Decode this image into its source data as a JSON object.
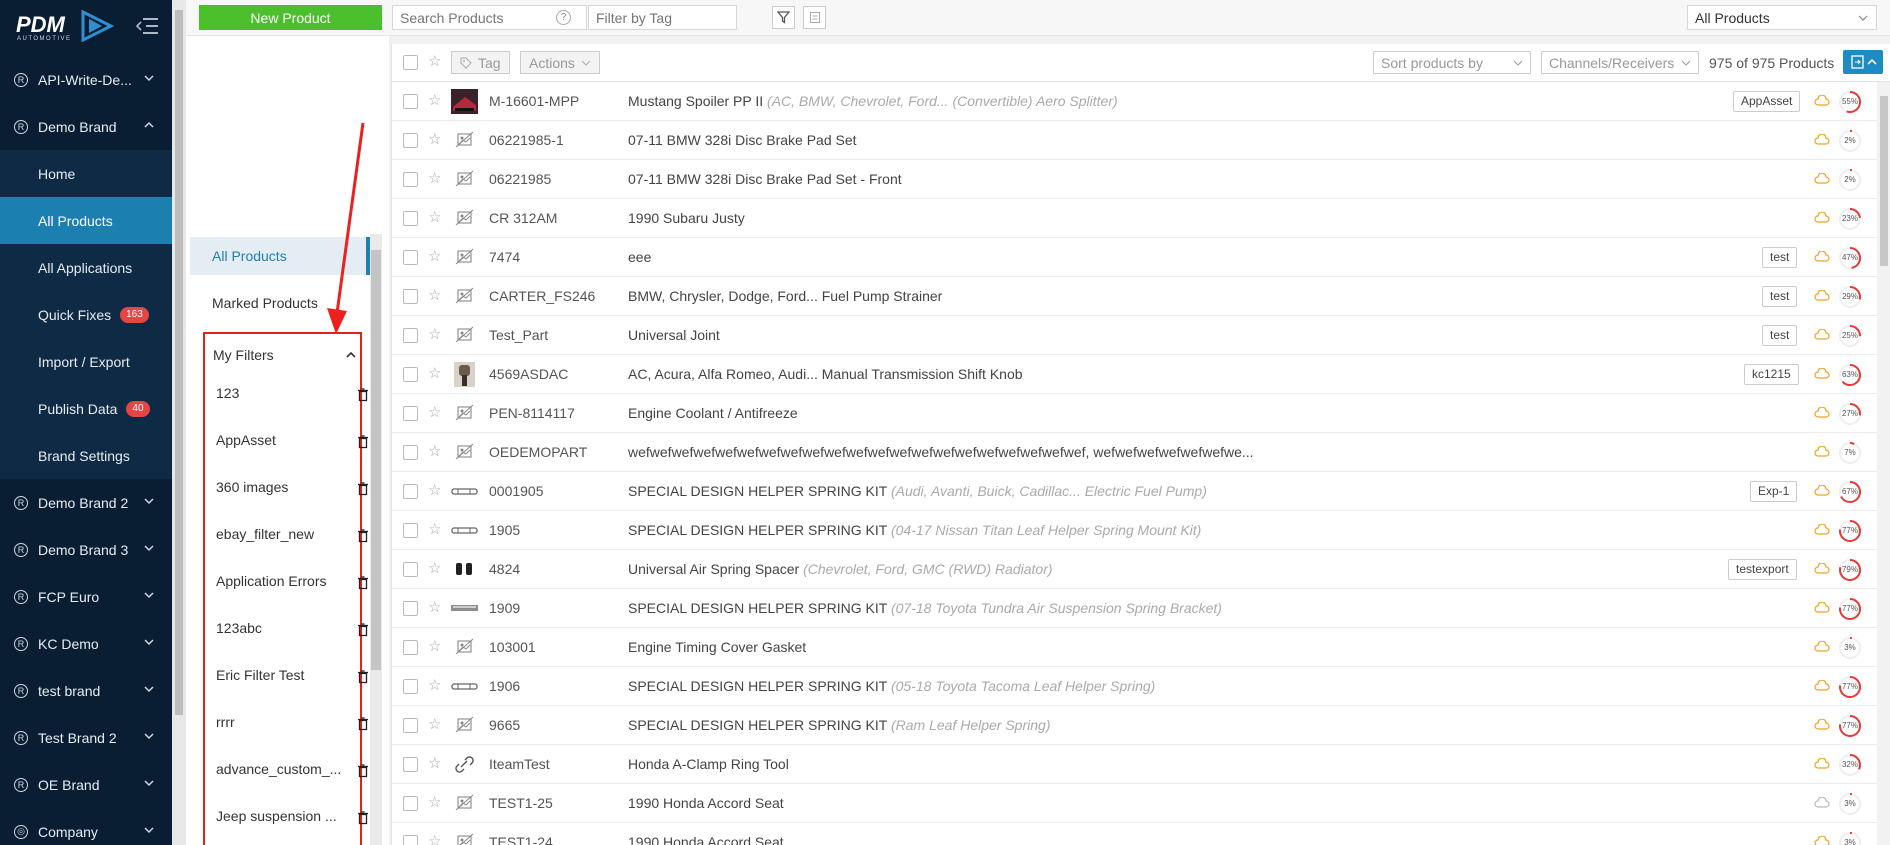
{
  "brand": {
    "logo_text": "PDM",
    "logo_sub": "AUTOMOTIVE"
  },
  "sidebar": {
    "groups": [
      {
        "label": "API-Write-De...",
        "open": false
      },
      {
        "label": "Demo Brand",
        "open": true
      }
    ],
    "sub_items": [
      {
        "label": "Home"
      },
      {
        "label": "All Products",
        "active": true
      },
      {
        "label": "All Applications"
      },
      {
        "label": "Quick Fixes",
        "badge": "163"
      },
      {
        "label": "Import / Export"
      },
      {
        "label": "Publish Data",
        "badge": "40"
      },
      {
        "label": "Brand Settings"
      }
    ],
    "more_groups": [
      "Demo Brand 2",
      "Demo Brand 3",
      "FCP Euro",
      "KC Demo",
      "test brand",
      "Test Brand 2",
      "OE Brand",
      "Company"
    ]
  },
  "topbar": {
    "new_product": "New Product",
    "search_placeholder": "Search Products",
    "tag_placeholder": "Filter by Tag",
    "scope": "All Products",
    "help": "?"
  },
  "filters": {
    "all_products": "All Products",
    "marked_products": "Marked Products",
    "my_filters": "My Filters",
    "items": [
      "123",
      "AppAsset",
      "360 images",
      "ebay_filter_new",
      "Application Errors",
      "123abc",
      "Eric Filter Test",
      "rrrr",
      "advance_custom_...",
      "Jeep suspension ..."
    ]
  },
  "list_header": {
    "tag": "Tag",
    "actions": "Actions",
    "sort": "Sort products by",
    "channels": "Channels/Receivers",
    "count": "975 of 975 Products"
  },
  "products": [
    {
      "sku": "M-16601-MPP",
      "name": "Mustang Spoiler PP II",
      "note": "(AC, BMW, Chevrolet, Ford... (Convertible) Aero Splitter)",
      "tag": "AppAsset",
      "pct": 55,
      "img": "photo"
    },
    {
      "sku": "06221985-1",
      "name": "07-11 BMW 328i Disc Brake Pad Set",
      "note": "",
      "tag": "",
      "pct": 2,
      "img": "none"
    },
    {
      "sku": "06221985",
      "name": "07-11 BMW 328i Disc Brake Pad Set - Front",
      "note": "",
      "tag": "",
      "pct": 2,
      "img": "none"
    },
    {
      "sku": "CR 312AM",
      "name": "1990 Subaru Justy",
      "note": "",
      "tag": "",
      "pct": 23,
      "img": "none"
    },
    {
      "sku": "7474",
      "name": "eee",
      "note": "",
      "tag": "test",
      "pct": 47,
      "img": "none"
    },
    {
      "sku": "CARTER_FS246",
      "name": "BMW, Chrysler, Dodge, Ford... Fuel Pump Strainer",
      "note": "",
      "tag": "test",
      "pct": 29,
      "img": "none"
    },
    {
      "sku": "Test_Part",
      "name": "Universal Joint",
      "note": "",
      "tag": "test",
      "pct": 25,
      "img": "none"
    },
    {
      "sku": "4569ASDAC",
      "name": "AC, Acura, Alfa Romeo, Audi... Manual Transmission Shift Knob",
      "note": "",
      "tag": "kc1215",
      "pct": 63,
      "img": "photo2"
    },
    {
      "sku": "PEN-8114117",
      "name": "Engine Coolant / Antifreeze",
      "note": "",
      "tag": "",
      "pct": 27,
      "img": "none"
    },
    {
      "sku": "OEDEMOPART",
      "name": "wefwefwefwefwefwefwefwefwefwefwefwefwefwefwefwefwefwefwefwefwef, wefwefwefwefwefwefwe...",
      "note": "",
      "tag": "",
      "pct": 7,
      "img": "none"
    },
    {
      "sku": "0001905",
      "name": "SPECIAL DESIGN HELPER SPRING KIT",
      "note": "(Audi, Avanti, Buick, Cadillac... Electric Fuel Pump)",
      "tag": "Exp-1",
      "pct": 67,
      "img": "spring"
    },
    {
      "sku": "1905",
      "name": "SPECIAL DESIGN HELPER SPRING KIT",
      "note": "(04-17 Nissan Titan Leaf Helper Spring Mount Kit)",
      "tag": "",
      "pct": 77,
      "img": "spring"
    },
    {
      "sku": "4824",
      "name": "Universal Air Spring Spacer",
      "note": "(Chevrolet, Ford, GMC (RWD) Radiator)",
      "tag": "testexport",
      "pct": 79,
      "img": "spacer"
    },
    {
      "sku": "1909",
      "name": "SPECIAL DESIGN HELPER SPRING KIT",
      "note": "(07-18 Toyota Tundra Air Suspension Spring Bracket)",
      "tag": "",
      "pct": 77,
      "img": "bar"
    },
    {
      "sku": "103001",
      "name": "Engine Timing Cover Gasket",
      "note": "",
      "tag": "",
      "pct": 3,
      "img": "none"
    },
    {
      "sku": "1906",
      "name": "SPECIAL DESIGN HELPER SPRING KIT",
      "note": "(05-18 Toyota Tacoma Leaf Helper Spring)",
      "tag": "",
      "pct": 77,
      "img": "spring"
    },
    {
      "sku": "9665",
      "name": "SPECIAL DESIGN HELPER SPRING KIT",
      "note": "(Ram Leaf Helper Spring)",
      "tag": "",
      "pct": 77,
      "img": "none"
    },
    {
      "sku": "IteamTest",
      "name": "Honda A-Clamp Ring Tool",
      "note": "",
      "tag": "",
      "pct": 32,
      "img": "link"
    },
    {
      "sku": "TEST1-25",
      "name": "1990 Honda Accord Seat",
      "note": "",
      "tag": "",
      "pct": 3,
      "img": "none"
    },
    {
      "sku": "TEST1-24",
      "name": "1990 Honda Accord Seat",
      "note": "",
      "tag": "",
      "pct": 3,
      "img": "none"
    }
  ],
  "colors": {
    "accent": "#1f7fae",
    "new_button": "#4cc02c",
    "badge": "#e64545",
    "highlight": "#e62020",
    "sidebar": "#0a1e33"
  }
}
